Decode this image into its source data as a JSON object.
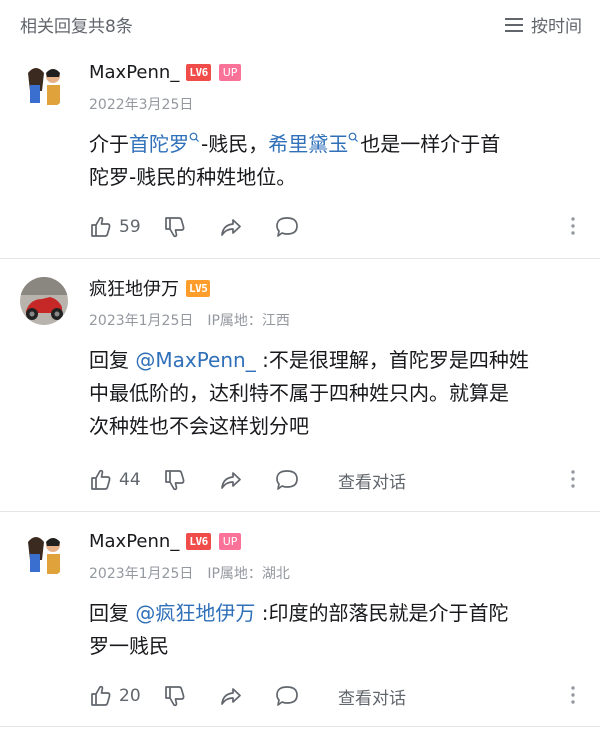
{
  "header": {
    "title": "相关回复共8条",
    "sort_label": "按时间"
  },
  "comments": [
    {
      "name": "MaxPenn_",
      "level": "LV6",
      "up_badge": "UP",
      "date": "2022年3月25日",
      "ip": "",
      "content_parts": {
        "p1": "介于",
        "link1": "首陀罗",
        "p2": "-贱民，",
        "link2": "希里黛玉",
        "p3": "也是一样介于首",
        "line2": "陀罗-贱民的种姓地位。"
      },
      "likes": "59",
      "view_conversation": ""
    },
    {
      "name": "疯狂地伊万",
      "level": "LV5",
      "date": "2023年1月25日",
      "ip": "IP属地：江西",
      "reply_prefix": "回复 ",
      "reply_to": "@MaxPenn_",
      "content_lines": [
        " :不是很理解，首陀罗是四种姓",
        "中最低阶的，达利特不属于四种姓只内。就算是",
        "次种姓也不会这样划分吧"
      ],
      "likes": "44",
      "view_conversation": "查看对话"
    },
    {
      "name": "MaxPenn_",
      "level": "LV6",
      "up_badge": "UP",
      "date": "2023年1月25日",
      "ip": "IP属地：湖北",
      "reply_prefix": "回复 ",
      "reply_to": "@疯狂地伊万",
      "content_lines": [
        " :印度的部落民就是介于首陀",
        "罗一贱民"
      ],
      "likes": "20",
      "view_conversation": "查看对话"
    }
  ],
  "colors": {
    "link": "#2f70b9",
    "secondary_text": "#9499a0",
    "lv6": "#f04c49",
    "lv5": "#ff9d2c",
    "up": "#fb7299"
  }
}
